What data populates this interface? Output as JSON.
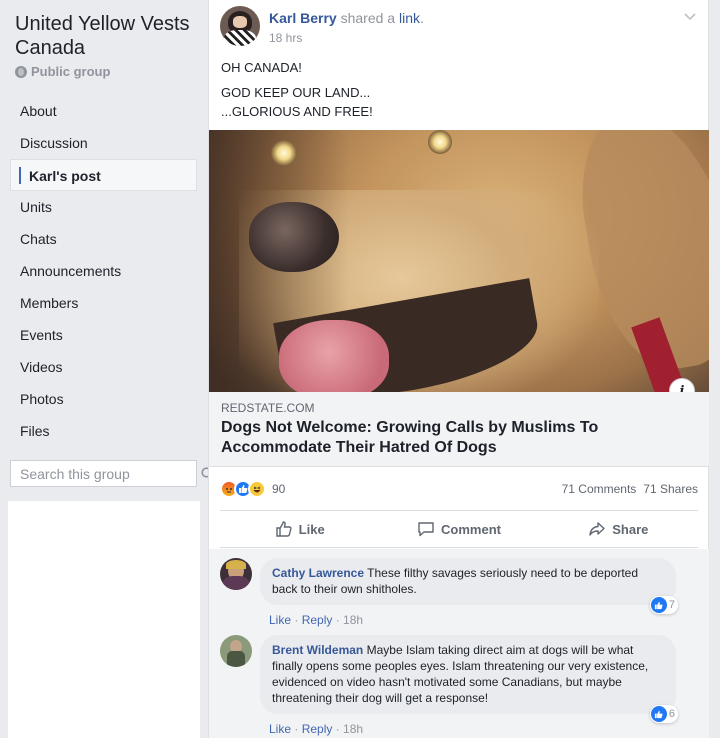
{
  "group": {
    "title": "United Yellow Vests Canada",
    "type": "Public group"
  },
  "nav": {
    "items": [
      {
        "label": "About"
      },
      {
        "label": "Discussion"
      },
      {
        "label": "Karl's post"
      },
      {
        "label": "Units"
      },
      {
        "label": "Chats"
      },
      {
        "label": "Announcements"
      },
      {
        "label": "Members"
      },
      {
        "label": "Events"
      },
      {
        "label": "Videos"
      },
      {
        "label": "Photos"
      },
      {
        "label": "Files"
      }
    ],
    "active_index": 2
  },
  "search": {
    "placeholder": "Search this group"
  },
  "post": {
    "author": "Karl Berry",
    "action": "shared a",
    "link_word": "link",
    "time": "18 hrs",
    "lines": [
      "OH CANADA!",
      "GOD KEEP OUR LAND...",
      "...GLORIOUS AND FREE!"
    ],
    "link": {
      "domain": "REDSTATE.COM",
      "title": "Dogs Not Welcome: Growing Calls by Muslims To Accommodate Their Hatred Of Dogs"
    },
    "reaction_count": "90",
    "comments_count": "71 Comments",
    "shares_count": "71 Shares",
    "actions": {
      "like": "Like",
      "comment": "Comment",
      "share": "Share"
    }
  },
  "comments": [
    {
      "name": "Cathy Lawrence",
      "text": "These filthy savages seriously need to be deported back to their own shitholes.",
      "like": "Like",
      "reply": "Reply",
      "time": "18h",
      "reactions": "7"
    },
    {
      "name": "Brent Wildeman",
      "text": "Maybe Islam taking direct aim at dogs will be what finally opens some peoples eyes. Islam threatening our very existence, evidenced on video hasn't motivated some Canadians, but maybe threatening their dog will get a response!",
      "like": "Like",
      "reply": "Reply",
      "time": "18h",
      "reactions": "6"
    }
  ],
  "colors": {
    "link_blue": "#365899",
    "accent": "#4267b2",
    "like_blue": "#2078f4",
    "bg": "#e9ebee"
  },
  "icons": [
    "globe-icon",
    "search-icon",
    "chevron-down-icon",
    "info-icon",
    "angry-reaction-icon",
    "like-reaction-icon",
    "haha-reaction-icon",
    "thumbs-up-icon",
    "comment-icon",
    "share-icon"
  ]
}
